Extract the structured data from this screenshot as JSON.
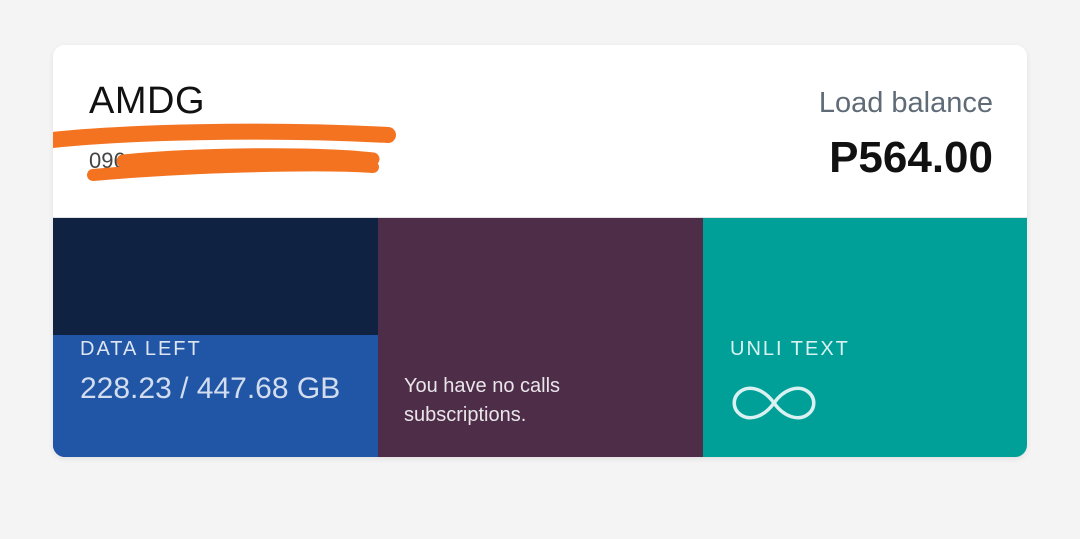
{
  "account": {
    "name": "AMDG",
    "number": "096"
  },
  "balance": {
    "label": "Load balance",
    "value": "P564.00"
  },
  "data_tile": {
    "label": "DATA LEFT",
    "value": "228.23 / 447.68 GB",
    "remaining_fraction": 0.51
  },
  "calls_tile": {
    "message": "You have no calls subscriptions."
  },
  "text_tile": {
    "label": "UNLI TEXT",
    "icon": "infinity-icon"
  },
  "colors": {
    "data_tile_bg": "#0f2242",
    "data_fill": "#2155a6",
    "calls_tile_bg": "#4e2d49",
    "text_tile_bg": "#00a098",
    "redaction": "#f47321"
  }
}
